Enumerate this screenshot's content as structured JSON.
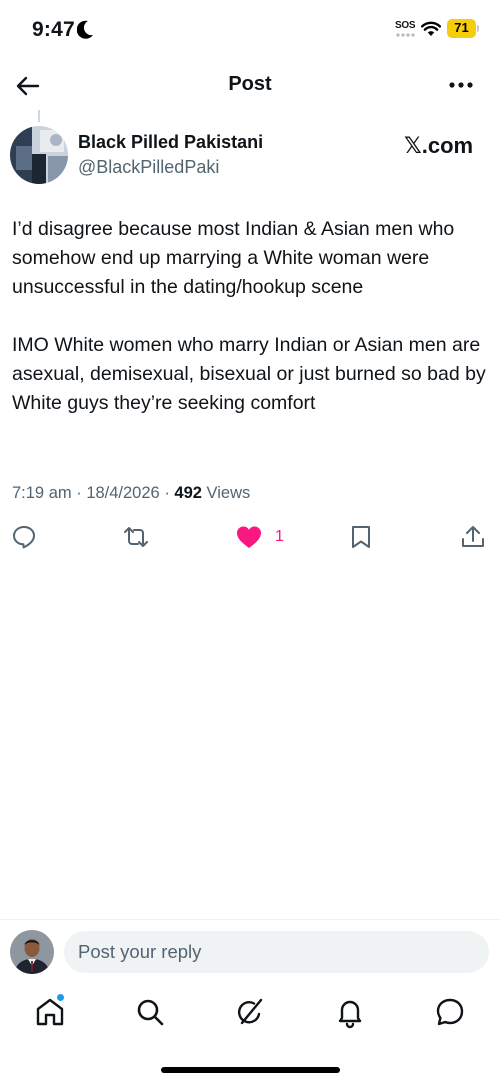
{
  "status_bar": {
    "time": "9:47",
    "sos": "SOS",
    "battery": "71"
  },
  "header": {
    "title": "Post"
  },
  "post": {
    "author_name": "Black Pilled Pakistani",
    "author_handle": "@BlackPilledPaki",
    "source_label": "𝕏.com",
    "paragraphs": [
      "I’d disagree because most Indian & Asian men who somehow end up marrying a White woman were unsuccessful in the dating/hookup scene",
      "IMO White women who marry Indian or Asian men are asexual, demisexual, bisexual or just burned so bad by White guys they’re seeking comfort"
    ],
    "time": "7:19 am",
    "date": "18/4/2026",
    "views_count": "492",
    "views_label": "Views"
  },
  "actions": {
    "like_count": "1",
    "like_color": "#f91880"
  },
  "reply": {
    "placeholder": "Post your reply"
  },
  "icons": {
    "back": "arrow-left-icon",
    "more": "more-horizontal-icon",
    "reply": "reply-icon",
    "repost": "repost-icon",
    "like": "heart-filled-icon",
    "bookmark": "bookmark-icon",
    "share": "share-icon",
    "nav": [
      "home-icon",
      "search-icon",
      "grok-icon",
      "notifications-icon",
      "messages-icon"
    ]
  },
  "colors": {
    "accent": "#1d9bf0",
    "secondary_text": "#536471",
    "battery": "#f5cd0a"
  }
}
